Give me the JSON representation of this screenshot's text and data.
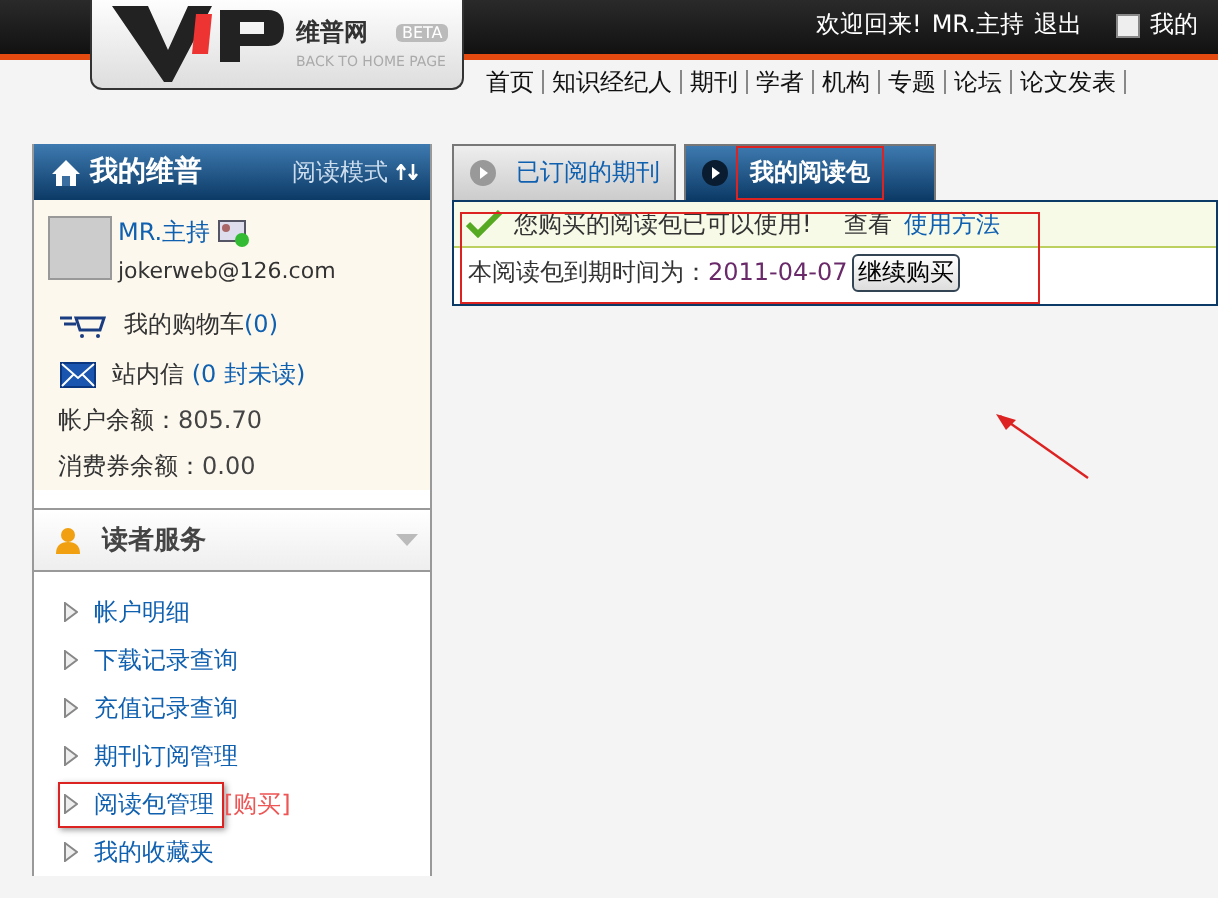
{
  "header": {
    "logo_name": "维普网",
    "logo_badge": "BETA",
    "logo_tagline": "BACK TO HOME PAGE",
    "welcome": "欢迎回来!",
    "user": "MR.主持",
    "logout": "退出",
    "my_menu": "我的"
  },
  "nav": [
    "首页",
    "知识经纪人",
    "期刊",
    "学者",
    "机构",
    "专题",
    "论坛",
    "论文发表"
  ],
  "sidebar": {
    "title": "我的维普",
    "mode": "阅读模式",
    "profile": {
      "name": "MR.主持",
      "email": "jokerweb@126.com"
    },
    "cart": {
      "label": "我的购物车",
      "count": "(0)"
    },
    "messages": {
      "label": "站内信",
      "count": "(0 封未读)"
    },
    "balance": {
      "label": "帐户余额：",
      "value": "805.70"
    },
    "voucher": {
      "label": "消费券余额：",
      "value": "0.00"
    },
    "services": {
      "title": "读者服务",
      "items": [
        {
          "label": "帐户明细",
          "annotated": false
        },
        {
          "label": "下载记录查询",
          "annotated": false
        },
        {
          "label": "充值记录查询",
          "annotated": false
        },
        {
          "label": "期刊订阅管理",
          "annotated": false
        },
        {
          "label": "阅读包管理",
          "extra": "[购买]",
          "annotated": true
        },
        {
          "label": "我的收藏夹",
          "annotated": false
        }
      ]
    }
  },
  "tabs": [
    {
      "label": "已订阅的期刊",
      "selected": false
    },
    {
      "label": "我的阅读包",
      "selected": true
    }
  ],
  "notice": {
    "message": "您购买的阅读包已可以使用!",
    "view": "查看",
    "link": "使用方法"
  },
  "expiry": {
    "label": "本阅读包到期时间为：",
    "date": "2011-04-07",
    "button": "继续购买"
  }
}
